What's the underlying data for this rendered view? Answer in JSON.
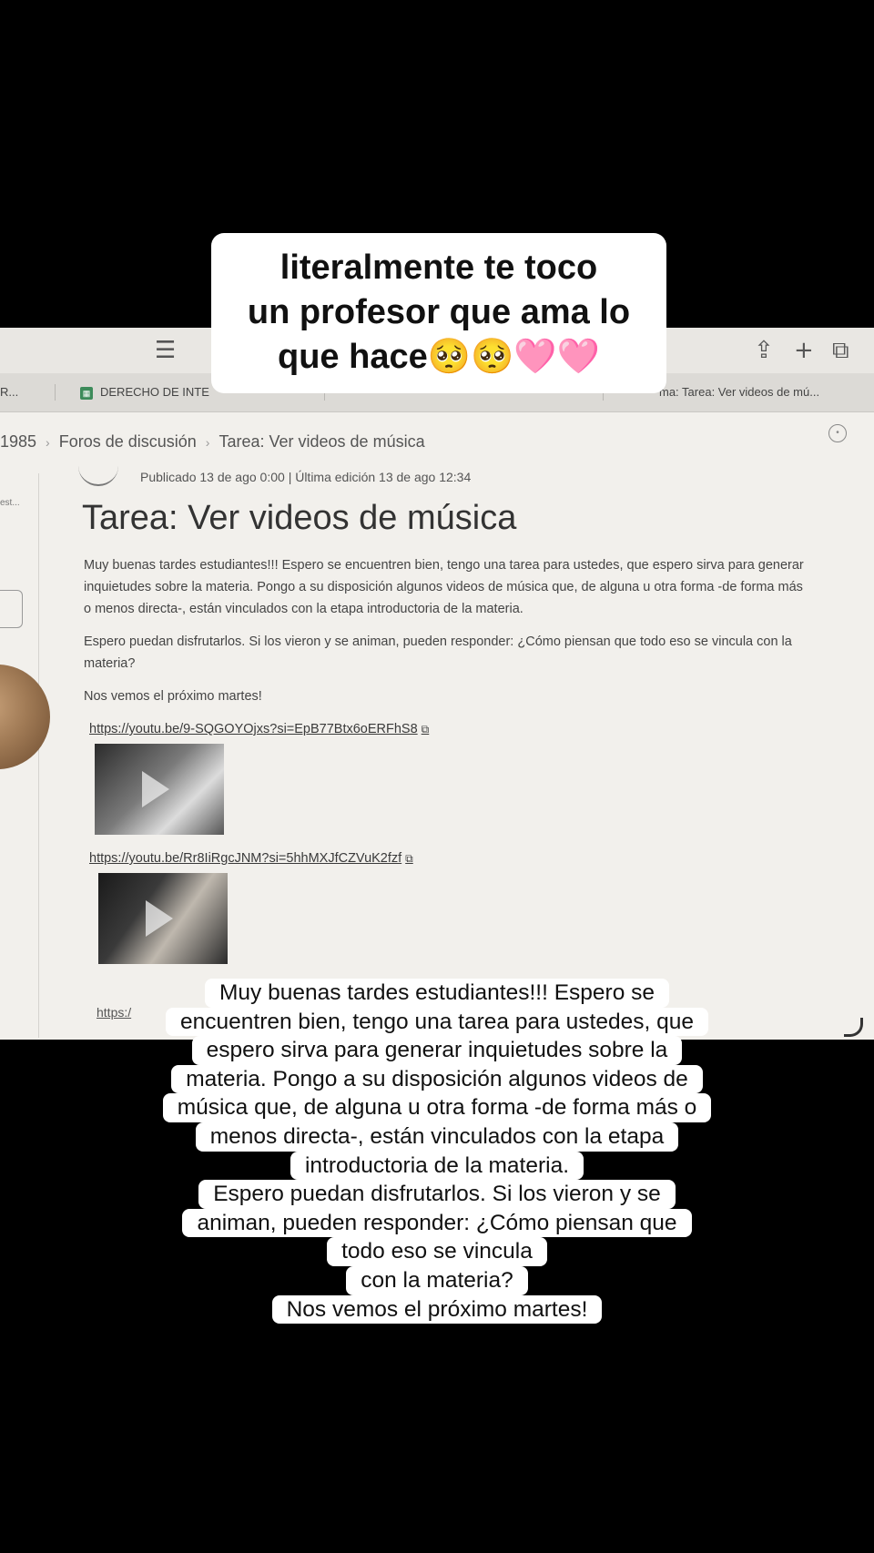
{
  "overlay": {
    "lines": [
      "literalmente te toco",
      "un profesor que ama lo",
      "que hace🥺🥺🩷🩷"
    ]
  },
  "browser": {
    "icons": [
      "sidebar-icon",
      "share-icon",
      "new-tab-icon",
      "tabs-icon"
    ],
    "tabs": [
      "R...",
      "DERECHO DE INTE",
      "ma: Tarea: Ver videos de mú..."
    ]
  },
  "breadcrumb": {
    "items": [
      "1985",
      "Foros de discusión",
      "Tarea: Ver videos de música"
    ]
  },
  "sidebar": {
    "snippet": "est..."
  },
  "post": {
    "meta": "Publicado 13 de ago 0:00  |  Última edición 13 de ago 12:34",
    "title": "Tarea: Ver videos de música",
    "paragraph1": "Muy buenas tardes estudiantes!!! Espero se encuentren bien, tengo una tarea para ustedes, que espero sirva para generar inquietudes sobre la materia. Pongo a su disposición algunos videos de música que, de alguna u otra forma -de forma más o menos directa-, están vinculados con la etapa introductoria de la materia.",
    "paragraph2": "Espero puedan disfrutarlos. Si los vieron y se animan, pueden responder: ¿Cómo piensan que todo eso se vincula con la materia?",
    "paragraph3": "Nos vemos el próximo martes!",
    "link1": "https://youtu.be/9-SQGOYOjxs?si=EpB77Btx6oERFhS8",
    "link2": "https://youtu.be/Rr8IiRgcJNM?si=5hhMXJfCZVuK2fzf",
    "link3": "https:/"
  },
  "caption": {
    "lines": [
      "Muy buenas tardes estudiantes!!! Espero se",
      "encuentren bien, tengo una tarea para ustedes, que",
      "espero sirva para generar inquietudes sobre la",
      "materia. Pongo a su disposición algunos videos de",
      "música que, de alguna u otra forma -de forma más o",
      "menos directa-, están vinculados con la etapa",
      "introductoria de la materia.",
      "Espero puedan disfrutarlos. Si los vieron y se",
      "animan, pueden responder: ¿Cómo piensan que",
      "todo eso se vincula",
      "con la materia?",
      "Nos vemos el próximo martes!"
    ]
  }
}
